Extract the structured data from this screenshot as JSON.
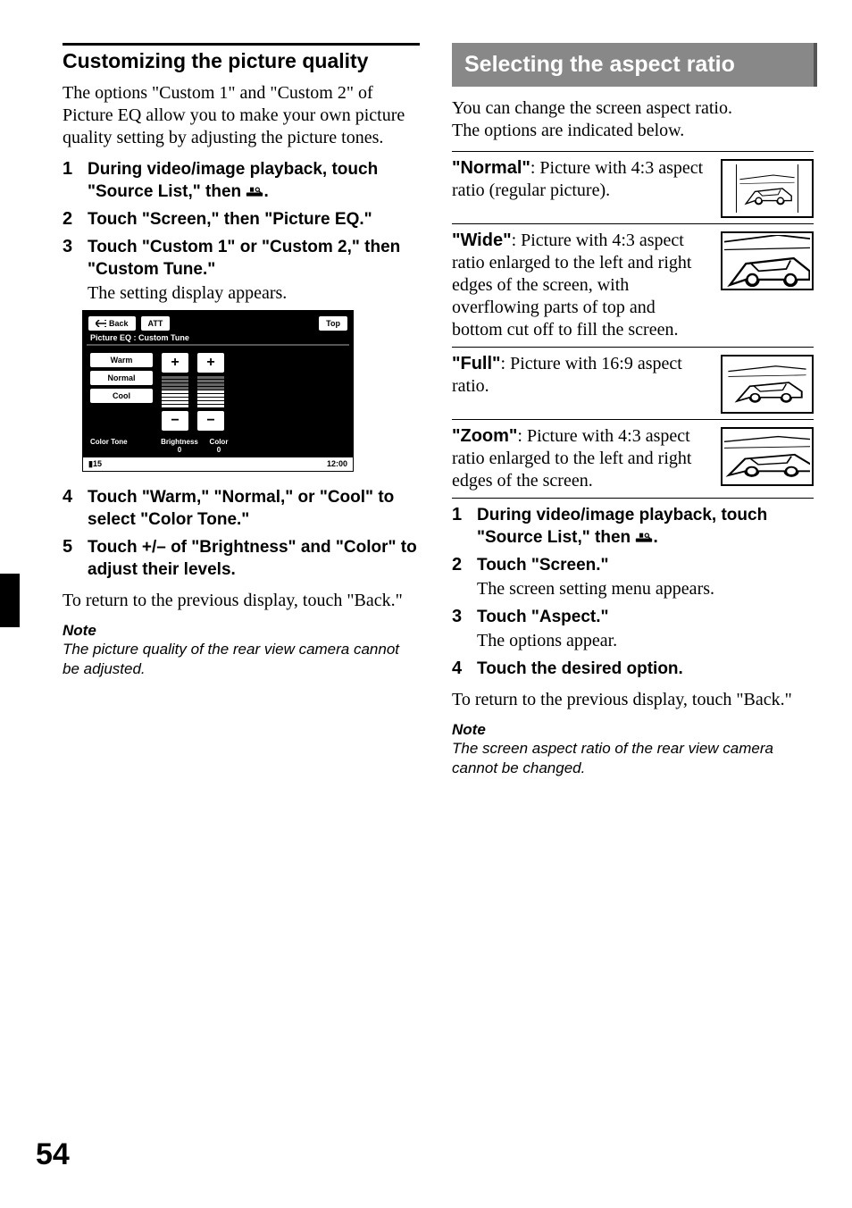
{
  "page_number": "54",
  "left": {
    "title": "Customizing the picture quality",
    "intro": "The options \"Custom 1\" and \"Custom 2\" of Picture EQ allow you to make your own picture quality setting by adjusting the picture tones.",
    "steps": [
      {
        "n": "1",
        "instr": "During video/image playback, touch \"Source List,\" then ",
        "icon": "settings",
        "instr_tail": "."
      },
      {
        "n": "2",
        "instr": "Touch \"Screen,\" then \"Picture EQ.\""
      },
      {
        "n": "3",
        "instr": "Touch \"Custom 1\" or \"Custom 2,\" then \"Custom Tune.\"",
        "sub": "The setting display appears."
      },
      {
        "n": "4",
        "instr": "Touch \"Warm,\" \"Normal,\" or \"Cool\" to select \"Color Tone.\""
      },
      {
        "n": "5",
        "instr": "Touch +/– of \"Brightness\" and \"Color\" to adjust their levels."
      }
    ],
    "return_note": "To return to the previous display, touch \"Back.\"",
    "note_head": "Note",
    "note_body": "The picture quality of the rear view camera cannot be adjusted.",
    "device": {
      "back": "Back",
      "att": "ATT",
      "top": "Top",
      "subtitle": "Picture EQ : Custom Tune",
      "tones": [
        "Warm",
        "Normal",
        "Cool"
      ],
      "col_tone": "Color Tone",
      "col_brightness": "Brightness",
      "col_color": "Color",
      "val_brightness": "0",
      "val_color": "0",
      "footer_left": "15",
      "footer_right": "12:00"
    }
  },
  "right": {
    "banner": "Selecting the aspect ratio",
    "intro": "You can change the screen aspect ratio.\nThe options are indicated below.",
    "options": [
      {
        "name": "\"Normal\"",
        "desc": ": Picture with 4:3 aspect ratio (regular picture).",
        "mode": "normal"
      },
      {
        "name": "\"Wide\"",
        "desc": ": Picture with 4:3 aspect ratio enlarged to the left and right edges of the screen, with overflowing parts of top and bottom cut off to fill the screen.",
        "mode": "wide"
      },
      {
        "name": "\"Full\"",
        "desc": ": Picture with 16:9 aspect ratio.",
        "mode": "full"
      },
      {
        "name": "\"Zoom\"",
        "desc": ": Picture with 4:3 aspect ratio enlarged to the left and right edges of the screen.",
        "mode": "zoom"
      }
    ],
    "steps": [
      {
        "n": "1",
        "instr": "During video/image playback, touch \"Source List,\" then ",
        "icon": "settings",
        "instr_tail": "."
      },
      {
        "n": "2",
        "instr": "Touch \"Screen.\"",
        "sub": "The screen setting menu appears."
      },
      {
        "n": "3",
        "instr": "Touch \"Aspect.\"",
        "sub": "The options appear."
      },
      {
        "n": "4",
        "instr": "Touch the desired option."
      }
    ],
    "return_note": "To return to the previous display, touch \"Back.\"",
    "note_head": "Note",
    "note_body": "The screen aspect ratio of the rear view camera cannot be changed."
  }
}
